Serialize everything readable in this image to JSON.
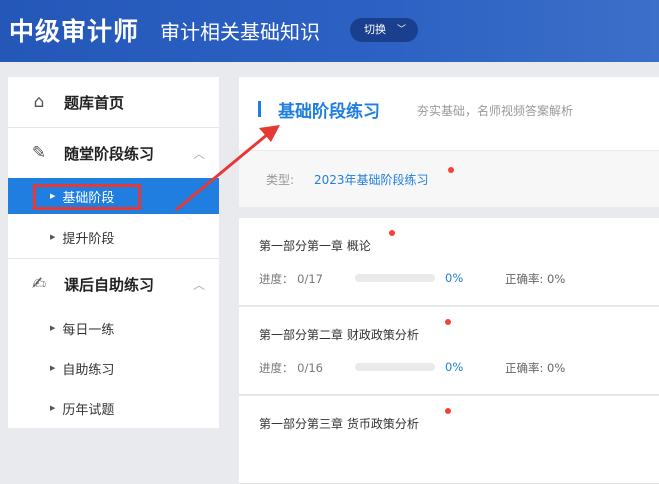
{
  "header": {
    "logo": "中级审计师",
    "subject": "审计相关基础知识",
    "switch_label": "切换"
  },
  "sidebar": {
    "home": "题库首页",
    "class_practice": "随堂阶段练习",
    "class_items": [
      "基础阶段",
      "提升阶段"
    ],
    "self_practice": "课后自助练习",
    "self_items": [
      "每日一练",
      "自助练习",
      "历年试题"
    ]
  },
  "main": {
    "title": "基础阶段练习",
    "tagline": "夯实基础，名师视频答案解析",
    "type_label": "类型:",
    "type_value": "2023年基础阶段练习",
    "chapters": [
      {
        "title": "第一部分第一章 概论",
        "progress_label": "进度：",
        "progress": "0/17",
        "percent": "0%",
        "percent_value": 0,
        "accuracy": "正确率: 0%"
      },
      {
        "title": "第一部分第二章 财政政策分析",
        "progress_label": "进度：",
        "progress": "0/16",
        "percent": "0%",
        "percent_value": 0,
        "accuracy": "正确率: 0%"
      },
      {
        "title": "第一部分第三章 货币政策分析"
      }
    ]
  },
  "colors": {
    "accent": "#1f7ee0",
    "header": "#2457b8",
    "annotation": "#e53935"
  }
}
